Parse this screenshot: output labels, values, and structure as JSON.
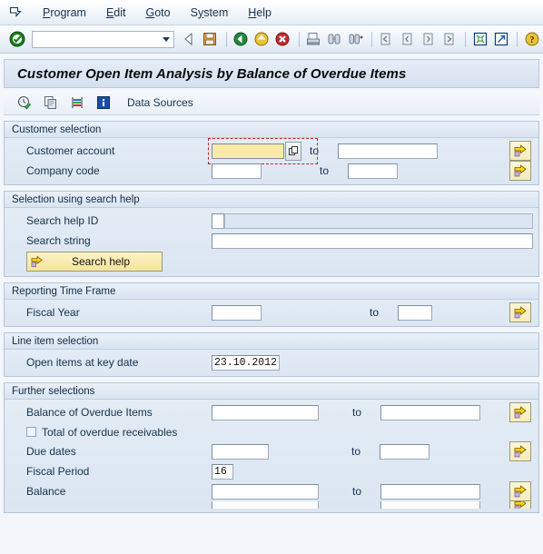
{
  "window": {
    "system_icon": "sap-menu-icon"
  },
  "menubar": {
    "items": [
      {
        "label": "Program",
        "accel": "P"
      },
      {
        "label": "Edit",
        "accel": "E"
      },
      {
        "label": "Goto",
        "accel": "G"
      },
      {
        "label": "System",
        "accel": "y"
      },
      {
        "label": "Help",
        "accel": "H"
      }
    ]
  },
  "toolbar": {
    "enter_icon": "green-check-icon",
    "command_field_value": "",
    "command_field_dropdown": "chevron-down-icon",
    "icons": [
      "back-triangle-icon",
      "save-icon",
      "back-green-icon",
      "exit-yellow-icon",
      "cancel-red-icon",
      "print-icon",
      "find-icon",
      "find-next-icon",
      "first-page-icon",
      "previous-page-icon",
      "next-page-icon",
      "last-page-icon",
      "new-session-icon",
      "create-shortcut-icon",
      "help-icon"
    ]
  },
  "title": {
    "text": "Customer Open Item Analysis by Balance of Overdue Items"
  },
  "apptoolbar": {
    "icons": [
      "execute-clock-icon",
      "copy-variant-icon",
      "layout-bars-icon",
      "info-blue-icon"
    ],
    "data_sources_label": "Data Sources"
  },
  "groups": [
    {
      "id": "customer-selection",
      "title": "Customer selection",
      "rows": [
        {
          "label": "Customer account",
          "from_value": "",
          "focused": true,
          "has_f4": true,
          "to_label": "to",
          "to_value": "",
          "multi_button": "multiple-selection-arrow-icon"
        },
        {
          "label": "Company code",
          "from_value": "",
          "focused": false,
          "has_f4": false,
          "to_label": "to",
          "to_value": "",
          "multi_button": "multiple-selection-arrow-icon"
        }
      ]
    },
    {
      "id": "selection-using-search-help",
      "title": "Selection using search help",
      "search_help_id_label": "Search help ID",
      "search_help_id_value": "",
      "search_help_desc_value": "",
      "search_string_label": "Search string",
      "search_string_value": "",
      "search_help_button_label": "Search help",
      "search_help_button_icon": "yellow-arrow-icon"
    },
    {
      "id": "reporting-time-frame",
      "title": "Reporting Time Frame",
      "rows": [
        {
          "label": "Fiscal Year",
          "from_value": "",
          "to_label": "to",
          "to_value": "",
          "multi_button": "multiple-selection-arrow-icon"
        }
      ]
    },
    {
      "id": "line-item-selection",
      "title": "Line item selection",
      "rows": [
        {
          "label": "Open items at key date",
          "from_value": "23.10.2012"
        }
      ]
    },
    {
      "id": "further-selections",
      "title": "Further selections",
      "rows": [
        {
          "label": "Balance of Overdue Items",
          "from_value": "",
          "to_label": "to",
          "to_value": "",
          "multi_button": "multiple-selection-arrow-icon"
        },
        {
          "checkbox_label": "Total of overdue receivables",
          "checked": false
        },
        {
          "label": "Due dates",
          "from_value": "",
          "to_label": "to",
          "to_value": "",
          "multi_button": "multiple-selection-arrow-icon"
        },
        {
          "label": "Fiscal Period",
          "from_value": "16"
        },
        {
          "label": "Balance",
          "from_value": "",
          "to_label": "to",
          "to_value": "",
          "multi_button": "multiple-selection-arrow-icon"
        }
      ]
    }
  ],
  "colors": {
    "focus_field_bg": "#fbe9a8",
    "focus_outline": "#bb2530",
    "panel_bg": "#dde8f3",
    "button_yellow": "#f4e49a",
    "title_text": "#0a0a0a"
  }
}
